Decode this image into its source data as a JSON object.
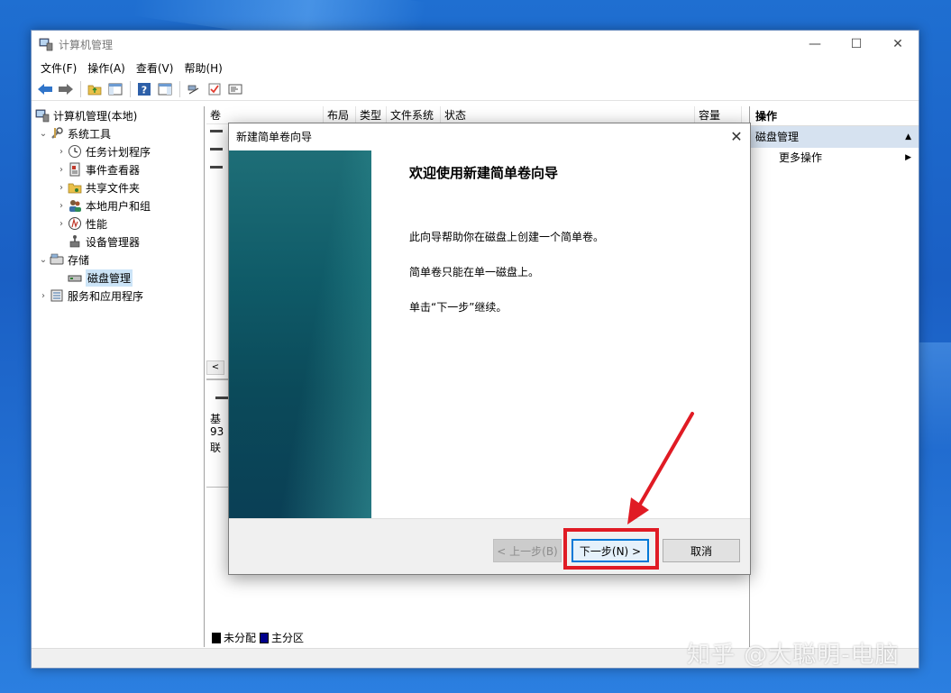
{
  "window": {
    "title": "计算机管理",
    "controls": {
      "minimize": "—",
      "maximize": "☐",
      "close": "✕"
    }
  },
  "menu": [
    {
      "label": "文件(F)"
    },
    {
      "label": "操作(A)"
    },
    {
      "label": "查看(V)"
    },
    {
      "label": "帮助(H)"
    }
  ],
  "tree": {
    "root": "计算机管理(本地)",
    "system_tools": "系统工具",
    "task_scheduler": "任务计划程序",
    "event_viewer": "事件查看器",
    "shared_folders": "共享文件夹",
    "local_users": "本地用户和组",
    "performance": "性能",
    "device_manager": "设备管理器",
    "storage": "存储",
    "disk_management": "磁盘管理",
    "services_apps": "服务和应用程序"
  },
  "list_columns": [
    "卷",
    "布局",
    "类型",
    "文件系统",
    "状态",
    "容量"
  ],
  "lower_pane": {
    "disk_label_fragment": "基",
    "size_fragment": "93",
    "status_fragment": "联",
    "legend_unallocated": "未分配",
    "legend_primary": "主分区"
  },
  "actions": {
    "header": "操作",
    "section": "磁盘管理",
    "more": "更多操作"
  },
  "dialog": {
    "title": "新建简单卷向导",
    "heading": "欢迎使用新建简单卷向导",
    "p1": "此向导帮助你在磁盘上创建一个简单卷。",
    "p2": "简单卷只能在单一磁盘上。",
    "p3": "单击“下一步”继续。",
    "back_button": "< 上一步(B)",
    "next_button": "下一步(N) >",
    "cancel_button": "取消",
    "close": "✕"
  },
  "watermark": "知乎 @大聪明-电脑",
  "colors": {
    "highlight_red": "#e01b24",
    "accent_blue": "#0078d7",
    "banner_teal": "#0f5b68"
  }
}
